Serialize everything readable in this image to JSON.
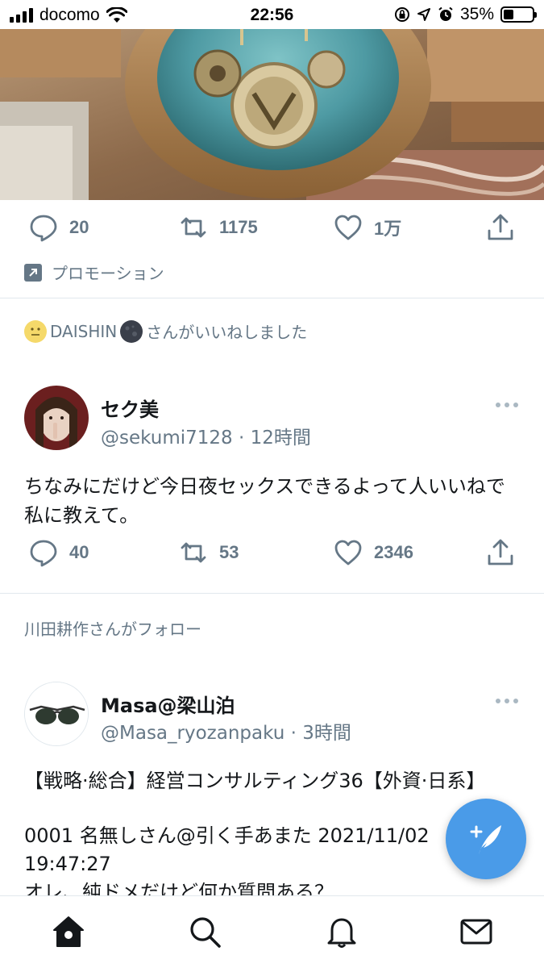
{
  "status_bar": {
    "carrier": "docomo",
    "time": "22:56",
    "battery_percent": "35%",
    "battery_level": 0.35,
    "icons": [
      "signal-icon",
      "wifi-icon",
      "orientation-lock-icon",
      "location-icon",
      "alarm-icon",
      "battery-icon"
    ]
  },
  "promo_tweet": {
    "image_description_icon": "wooden-watch-image",
    "replies": "20",
    "retweets": "1175",
    "likes": "1万",
    "promotion_label": "プロモーション"
  },
  "tweet1": {
    "social_context_name": "DAISHIN",
    "social_context_suffix": "さんがいいねしました",
    "display_name": "セク美",
    "handle": "@sekumi7128",
    "time": "· 12時間",
    "text": "ちなみにだけど今日夜セックスできるよって人いいねで私に教えて。",
    "replies": "40",
    "retweets": "53",
    "likes": "2346"
  },
  "tweet2": {
    "social_context": "川田耕作さんがフォロー",
    "display_name": "Masa@梁山泊",
    "handle": "@Masa_ryozanpaku",
    "time": "· 3時間",
    "line1": "【戦略·総合】経営コンサルティング36【外資·日系】",
    "line2": "0001 名無しさん@引く手あまた 2021/11/02",
    "line3": "19:47:27",
    "line4": "オレ、純ドメだけど何か質問ある？"
  },
  "tab_bar": [
    "home-icon",
    "search-icon",
    "notifications-icon",
    "messages-icon"
  ],
  "colors": {
    "accent": "#1da1f2",
    "fab": "#4a9be8",
    "secondary_text": "#657786"
  }
}
